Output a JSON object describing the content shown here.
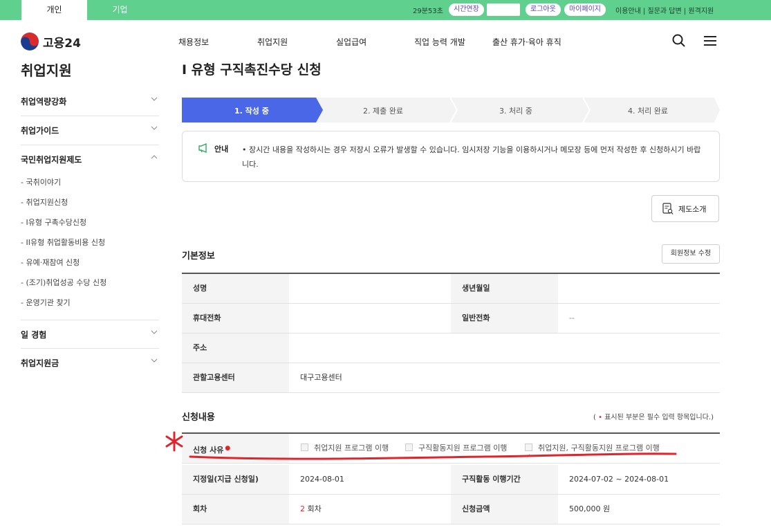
{
  "topbar": {
    "tab_personal": "개인",
    "tab_company": "기업",
    "timer": "29분53초",
    "extend": "시간연장",
    "logout": "로그아웃",
    "mypage": "마이페이지",
    "links": "이용안내 | 질문과 답변 | 원격지원"
  },
  "header": {
    "logo": "고용24",
    "nav": [
      "채용정보",
      "취업지원",
      "실업급여",
      "직업 능력 개발",
      "출산 휴가·육아 휴직"
    ]
  },
  "sidebar": {
    "title": "취업지원",
    "groups": [
      "취업역량강화",
      "취업가이드",
      "국민취업지원제도",
      "일 경험",
      "취업지원금"
    ],
    "subitems": [
      "- 국취이야기",
      "- 취업지원신청",
      "- I유형 구촉수당신청",
      "- II유형 취업활동비용 신청",
      "- 유예·재참여 신청",
      "- (조기)취업성공 수당 신청",
      "- 운영기관 찾기"
    ]
  },
  "main": {
    "title": "I 유형 구직촉진수당 신청",
    "steps": [
      "1. 작성 중",
      "2. 제출 완료",
      "3. 처리 중",
      "4. 처리 완료"
    ],
    "notice_tag": "안내",
    "notice_text": "• 장시간 내용을 작성하시는 경우 저장시 오류가 발생할 수 있습니다. 임시저장 기능을 이용하시거나 메모장 등에 먼저 작성한 후 신청하시기 바랍니다.",
    "intro_button": "제도소개",
    "basic_title": "기본정보",
    "edit_button": "회원정보 수정",
    "basic": {
      "name_label": "성명",
      "name_value": "",
      "birth_label": "생년월일",
      "birth_value": "",
      "mobile_label": "휴대전화",
      "mobile_value": "",
      "phone_label": "일반전화",
      "phone_value": "--",
      "addr_label": "주소",
      "addr_value": "",
      "center_label": "관할고용센터",
      "center_value": "대구고용센터"
    },
    "apply_title": "신청내용",
    "required_note_pre": "(",
    "required_note_post": "표시된 부분은 필수 입력 항목입니다.)",
    "apply": {
      "reason_label": "신청 사유",
      "options": [
        "취업지원 프로그램 이행",
        "구직활동지원 프로그램 이행",
        "취업지원, 구직활동지원 프로그램 이행"
      ],
      "selected_index": 2,
      "date_label": "지정일(지급 신청일)",
      "date_value": "2024-08-01",
      "period_label": "구직활동 이행기간",
      "period_value": "2024-07-02 ~ 2024-08-01",
      "round_label": "회차",
      "round_num": "2",
      "round_unit": "회차",
      "amount_label": "신청금액",
      "amount_value": "500,000 원"
    }
  },
  "colors": {
    "topbar": "#5fd08e",
    "step_active": "#4a67e8",
    "annotation": "#e0242c"
  }
}
